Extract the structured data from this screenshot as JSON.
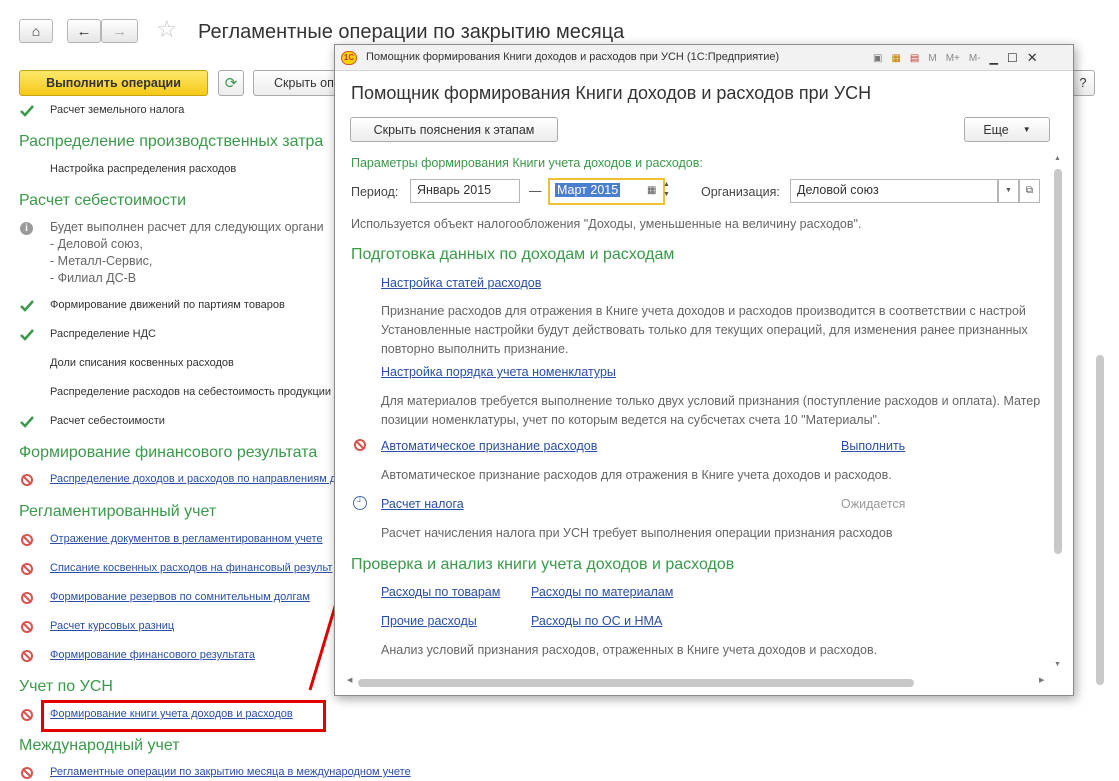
{
  "main": {
    "title": "Регламентные операции по закрытию месяца",
    "toolbar": {
      "run_label": "Выполнить операции",
      "hide_label": "Скрыть оп",
      "help_label": "?"
    },
    "items": [
      {
        "kind": "check",
        "text": "Расчет земельного налога"
      },
      {
        "kind": "header",
        "text": "Распределение производственных затра"
      },
      {
        "kind": "plain",
        "text": "Настройка распределения расходов"
      },
      {
        "kind": "header",
        "text": "Расчет себестоимости"
      },
      {
        "kind": "info",
        "lines": [
          "Будет выполнен расчет для следующих органи",
          "- Деловой союз,",
          "- Металл-Сервис,",
          "- Филиал ДС-В"
        ]
      },
      {
        "kind": "check",
        "text": "Формирование движений по партиям товаров"
      },
      {
        "kind": "check",
        "text": "Распределение НДС"
      },
      {
        "kind": "plain",
        "text": "Доли списания косвенных расходов"
      },
      {
        "kind": "plain",
        "text": "Распределение расходов на себестоимость продукции"
      },
      {
        "kind": "check",
        "text": "Расчет себестоимости"
      },
      {
        "kind": "header",
        "text": "Формирование финансового результата"
      },
      {
        "kind": "forbid",
        "text": "Распределение доходов и расходов по направлениям д"
      },
      {
        "kind": "header",
        "text": "Регламентированный учет"
      },
      {
        "kind": "forbid",
        "text": "Отражение документов в регламентированном учете"
      },
      {
        "kind": "forbid",
        "text": "Списание косвенных расходов на финансовый результ"
      },
      {
        "kind": "forbid",
        "text": "Формирование резервов по сомнительным долгам"
      },
      {
        "kind": "forbid",
        "text": "Расчет курсовых разниц"
      },
      {
        "kind": "forbid",
        "text": "Формирование финансового результата"
      },
      {
        "kind": "header",
        "text": "Учет по УСН"
      },
      {
        "kind": "forbid",
        "text": "Формирование книги учета доходов и расходов"
      },
      {
        "kind": "header",
        "text": "Международный учет"
      },
      {
        "kind": "forbid",
        "text": "Регламентные операции по закрытию месяца в международном учете"
      }
    ]
  },
  "dialog": {
    "window_title": "Помощник формирования Книги доходов и расходов при УСН  (1С:Предприятие)",
    "window_buttons": {
      "m": "M",
      "mplus": "M+",
      "mminus": "M-"
    },
    "heading": "Помощник формирования Книги доходов и расходов при УСН",
    "hide_hints_label": "Скрыть пояснения к этапам",
    "more_label": "Еще",
    "params_caption": "Параметры формирования Книги учета доходов и расходов:",
    "period_label": "Период:",
    "period_from": "Январь 2015",
    "dash": "—",
    "period_to": "Март 2015",
    "org_label": "Организация:",
    "org_value": "Деловой союз",
    "taxation_note": "Используется объект налогообложения \"Доходы, уменьшенные на величину расходов\".",
    "section1": "Подготовка данных по доходам и расходам",
    "link_expense_items": "Настройка статей расходов",
    "text_expense_items": [
      "Признание расходов для отражения в Книге учета доходов и расходов производится в соответствии с настрой",
      "Установленные настройки будут действовать только для текущих операций, для изменения ранее признанных",
      "повторно выполнить признание."
    ],
    "link_nomenclature": "Настройка порядка учета номенклатуры",
    "text_nomenclature": [
      "Для материалов требуется выполнение только двух условий признания (поступление расходов и оплата). Матер",
      "позиции номенклатуры, учет по которым ведется на субсчетах счета 10 \"Материалы\"."
    ],
    "link_auto": "Автоматическое признание расходов",
    "auto_action": "Выполнить",
    "text_auto": "Автоматическое признание расходов для отражения в Книге учета доходов и расходов.",
    "link_tax": "Расчет налога",
    "tax_status": "Ожидается",
    "text_tax": "Расчет начисления налога при УСН требует выполнения операции признания расходов",
    "section2": "Проверка и анализ книги учета доходов и расходов",
    "link_goods": "Расходы по товарам",
    "link_materials": "Расходы по материалам",
    "link_other": "Прочие расходы",
    "link_os": "Расходы по ОС и НМА",
    "text_analysis": "Анализ условий признания расходов, отраженных в Книге учета доходов и расходов."
  },
  "colors": {
    "accent_green": "#3a9a4a",
    "link_blue": "#2a4fa8",
    "highlight_red": "#e00000",
    "run_yellow": "#f5c918"
  }
}
